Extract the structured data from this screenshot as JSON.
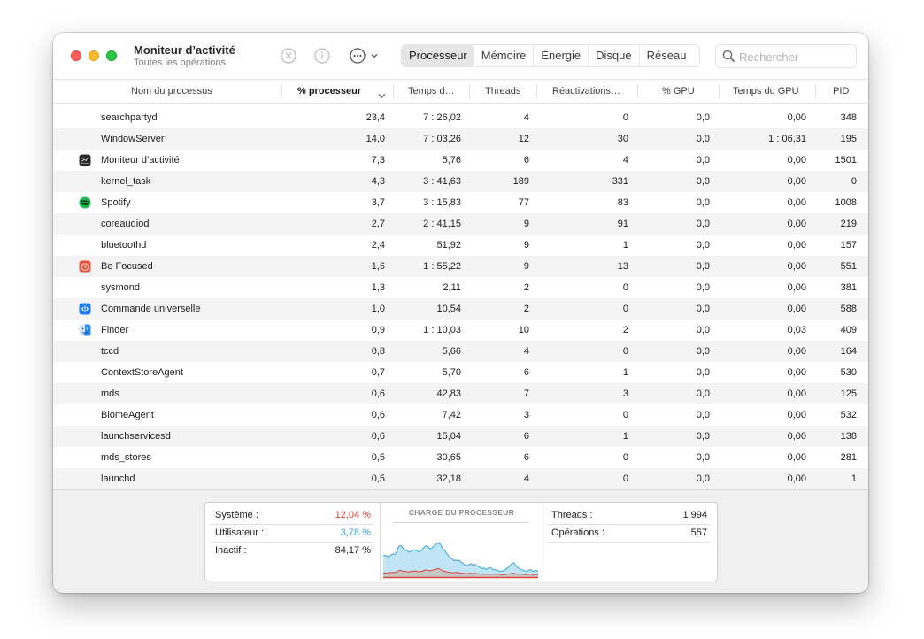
{
  "window": {
    "title": "Moniteur d’activité",
    "subtitle": "Toutes les opérations"
  },
  "toolbar": {
    "icons": [
      "stop-process-icon",
      "info-icon",
      "more-options-icon"
    ],
    "tabs": [
      {
        "label": "Processeur",
        "active": true
      },
      {
        "label": "Mémoire",
        "active": false
      },
      {
        "label": "Énergie",
        "active": false
      },
      {
        "label": "Disque",
        "active": false
      },
      {
        "label": "Réseau",
        "active": false
      }
    ],
    "search_placeholder": "Rechercher",
    "search_value": ""
  },
  "table": {
    "columns": [
      "Nom du processus",
      "% processeur",
      "Temps d…",
      "Threads",
      "Réactivations…",
      "% GPU",
      "Temps du GPU",
      "PID"
    ],
    "sorted_column": "% processeur",
    "sort_direction": "descending",
    "rows": [
      {
        "icon": "",
        "name": "searchpartyd",
        "cpu": "23,4",
        "time": "7 : 26,02",
        "threads": "4",
        "wakeups": "0",
        "gpu": "0,0",
        "gpu_time": "0,00",
        "pid": "348"
      },
      {
        "icon": "",
        "name": "WindowServer",
        "cpu": "14,0",
        "time": "7 : 03,26",
        "threads": "12",
        "wakeups": "30",
        "gpu": "0,0",
        "gpu_time": "1 : 06,31",
        "pid": "195"
      },
      {
        "icon": "activity-monitor-icon",
        "name": "Moniteur d’activité",
        "cpu": "7,3",
        "time": "5,76",
        "threads": "6",
        "wakeups": "4",
        "gpu": "0,0",
        "gpu_time": "0,00",
        "pid": "1501"
      },
      {
        "icon": "",
        "name": "kernel_task",
        "cpu": "4,3",
        "time": "3 : 41,63",
        "threads": "189",
        "wakeups": "331",
        "gpu": "0,0",
        "gpu_time": "0,00",
        "pid": "0"
      },
      {
        "icon": "spotify-icon",
        "name": "Spotify",
        "cpu": "3,7",
        "time": "3 : 15,83",
        "threads": "77",
        "wakeups": "83",
        "gpu": "0,0",
        "gpu_time": "0,00",
        "pid": "1008"
      },
      {
        "icon": "",
        "name": "coreaudiod",
        "cpu": "2,7",
        "time": "2 : 41,15",
        "threads": "9",
        "wakeups": "91",
        "gpu": "0,0",
        "gpu_time": "0,00",
        "pid": "219"
      },
      {
        "icon": "",
        "name": "bluetoothd",
        "cpu": "2,4",
        "time": "51,92",
        "threads": "9",
        "wakeups": "1",
        "gpu": "0,0",
        "gpu_time": "0,00",
        "pid": "157"
      },
      {
        "icon": "be-focused-icon",
        "name": "Be Focused",
        "cpu": "1,6",
        "time": "1 : 55,22",
        "threads": "9",
        "wakeups": "13",
        "gpu": "0,0",
        "gpu_time": "0,00",
        "pid": "551"
      },
      {
        "icon": "",
        "name": "sysmond",
        "cpu": "1,3",
        "time": "2,11",
        "threads": "2",
        "wakeups": "0",
        "gpu": "0,0",
        "gpu_time": "0,00",
        "pid": "381"
      },
      {
        "icon": "universal-control-icon",
        "name": "Commande universelle",
        "cpu": "1,0",
        "time": "10,54",
        "threads": "2",
        "wakeups": "0",
        "gpu": "0,0",
        "gpu_time": "0,00",
        "pid": "588"
      },
      {
        "icon": "finder-icon",
        "name": "Finder",
        "cpu": "0,9",
        "time": "1 : 10,03",
        "threads": "10",
        "wakeups": "2",
        "gpu": "0,0",
        "gpu_time": "0,03",
        "pid": "409"
      },
      {
        "icon": "",
        "name": "tccd",
        "cpu": "0,8",
        "time": "5,66",
        "threads": "4",
        "wakeups": "0",
        "gpu": "0,0",
        "gpu_time": "0,00",
        "pid": "164"
      },
      {
        "icon": "",
        "name": "ContextStoreAgent",
        "cpu": "0,7",
        "time": "5,70",
        "threads": "6",
        "wakeups": "1",
        "gpu": "0,0",
        "gpu_time": "0,00",
        "pid": "530"
      },
      {
        "icon": "",
        "name": "mds",
        "cpu": "0,6",
        "time": "42,83",
        "threads": "7",
        "wakeups": "3",
        "gpu": "0,0",
        "gpu_time": "0,00",
        "pid": "125"
      },
      {
        "icon": "",
        "name": "BiomeAgent",
        "cpu": "0,6",
        "time": "7,42",
        "threads": "3",
        "wakeups": "0",
        "gpu": "0,0",
        "gpu_time": "0,00",
        "pid": "532"
      },
      {
        "icon": "",
        "name": "launchservicesd",
        "cpu": "0,6",
        "time": "15,04",
        "threads": "6",
        "wakeups": "1",
        "gpu": "0,0",
        "gpu_time": "0,00",
        "pid": "138"
      },
      {
        "icon": "",
        "name": "mds_stores",
        "cpu": "0,5",
        "time": "30,65",
        "threads": "6",
        "wakeups": "0",
        "gpu": "0,0",
        "gpu_time": "0,00",
        "pid": "281"
      },
      {
        "icon": "",
        "name": "launchd",
        "cpu": "0,5",
        "time": "32,18",
        "threads": "4",
        "wakeups": "0",
        "gpu": "0,0",
        "gpu_time": "0,00",
        "pid": "1"
      }
    ]
  },
  "summary": {
    "system_label": "Système :",
    "system_value": "12,04 %",
    "user_label": "Utilisateur :",
    "user_value": "3,78 %",
    "idle_label": "Inactif :",
    "idle_value": "84,17 %",
    "threads_label": "Threads :",
    "threads_value": "1 994",
    "processes_label": "Opérations :",
    "processes_value": "557",
    "colors": {
      "system": "#e0443c",
      "user": "#3aa6dd"
    }
  },
  "chart_data": {
    "type": "area",
    "title": "CHARGE DU PROCESSEUR",
    "ylim": [
      0,
      100
    ],
    "series": [
      {
        "name": "Utilisateur",
        "color": "#3aa6dd",
        "values": [
          44,
          46,
          43,
          42,
          45,
          48,
          47,
          52,
          62,
          66,
          64,
          58,
          56,
          55,
          52,
          54,
          56,
          57,
          55,
          53,
          54,
          58,
          63,
          66,
          64,
          59,
          60,
          64,
          68,
          70,
          72,
          66,
          58,
          56,
          49,
          44,
          40,
          38,
          34,
          36,
          33,
          35,
          30,
          28,
          25,
          24,
          26,
          28,
          25,
          27,
          24,
          22,
          20,
          18,
          19,
          16,
          18,
          20,
          18,
          16,
          15,
          14,
          13,
          12,
          13,
          14,
          18,
          20,
          24,
          28,
          30,
          24,
          20,
          18,
          16,
          14,
          13,
          12,
          14,
          16,
          13,
          12,
          14,
          12
        ]
      },
      {
        "name": "Système",
        "color": "#e0443c",
        "values": [
          8,
          9,
          8,
          10,
          9,
          10,
          9,
          11,
          13,
          14,
          13,
          12,
          12,
          11,
          11,
          12,
          12,
          13,
          12,
          11,
          12,
          12,
          14,
          15,
          14,
          13,
          14,
          15,
          16,
          18,
          17,
          15,
          13,
          12,
          11,
          10,
          10,
          9,
          9,
          10,
          9,
          9,
          8,
          8,
          7,
          7,
          8,
          8,
          7,
          8,
          7,
          7,
          6,
          6,
          6,
          6,
          6,
          6,
          6,
          6,
          6,
          6,
          6,
          5,
          5,
          5,
          6,
          6,
          7,
          8,
          8,
          7,
          6,
          6,
          6,
          6,
          5,
          5,
          6,
          6,
          5,
          5,
          6,
          5
        ]
      }
    ]
  }
}
